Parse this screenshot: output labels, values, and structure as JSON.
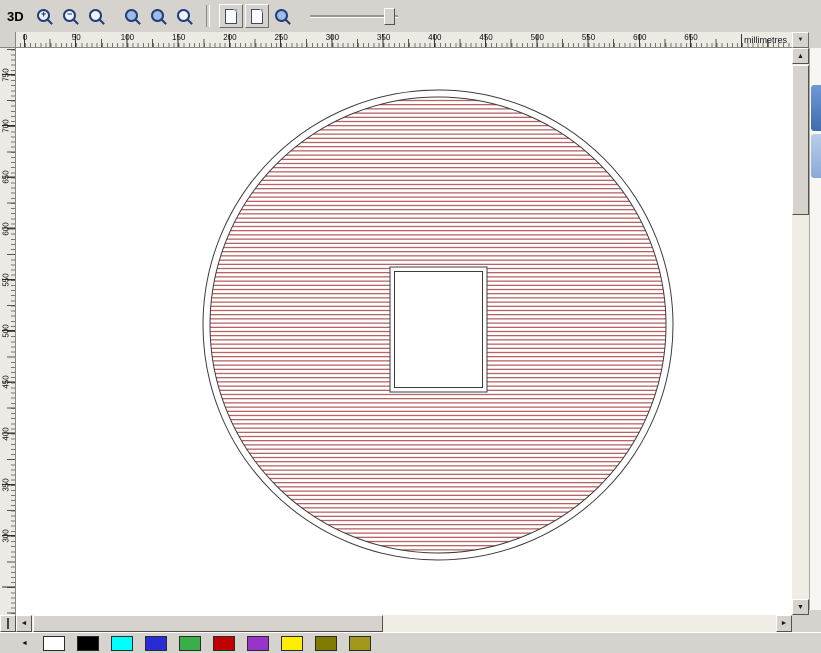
{
  "toolbar": {
    "mode_label": "3D",
    "icons": [
      {
        "name": "zoom-in-icon",
        "glyph": "+"
      },
      {
        "name": "zoom-out-icon",
        "glyph": "−"
      },
      {
        "name": "zoom-previous-icon",
        "glyph": ""
      },
      {
        "name": "zoom-one-to-one-icon",
        "glyph": ""
      },
      {
        "name": "zoom-selected-icon",
        "glyph": ""
      },
      {
        "name": "zoom-all-icon",
        "glyph": ""
      },
      {
        "name": "page-back-icon",
        "glyph": ""
      },
      {
        "name": "page-forward-icon",
        "glyph": ""
      },
      {
        "name": "zoom-page-icon",
        "glyph": ""
      }
    ]
  },
  "rulers": {
    "unit": "millimetres",
    "unit_dropdown_glyph": "▼",
    "horizontal_labels": [
      "0",
      "50",
      "100",
      "150",
      "200",
      "250",
      "300",
      "350",
      "400",
      "450",
      "500",
      "550",
      "600",
      "650"
    ],
    "vertical_labels": [
      "750",
      "700",
      "650",
      "600",
      "550",
      "500",
      "450",
      "400",
      "350",
      "300"
    ]
  },
  "drawing": {
    "page_color": "#ffffff",
    "outline_color": "#3c3c3c",
    "hatch_color": "#a13434"
  },
  "scrollbars": {
    "up_glyph": "▲",
    "down_glyph": "▼",
    "left_glyph": "◄",
    "right_glyph": "►"
  },
  "palette": {
    "nav_left_glyph": "◄",
    "swatches": [
      {
        "name": "white",
        "color": "#ffffff"
      },
      {
        "name": "black",
        "color": "#000000"
      },
      {
        "name": "cyan",
        "color": "#00ffff"
      },
      {
        "name": "blue",
        "color": "#2b2bd5"
      },
      {
        "name": "green",
        "color": "#3aae49"
      },
      {
        "name": "red",
        "color": "#c00000"
      },
      {
        "name": "purple",
        "color": "#9933cc"
      },
      {
        "name": "yellow",
        "color": "#ffee00"
      },
      {
        "name": "olive",
        "color": "#7f7b00"
      },
      {
        "name": "dark-yellow",
        "color": "#a39719"
      }
    ]
  }
}
